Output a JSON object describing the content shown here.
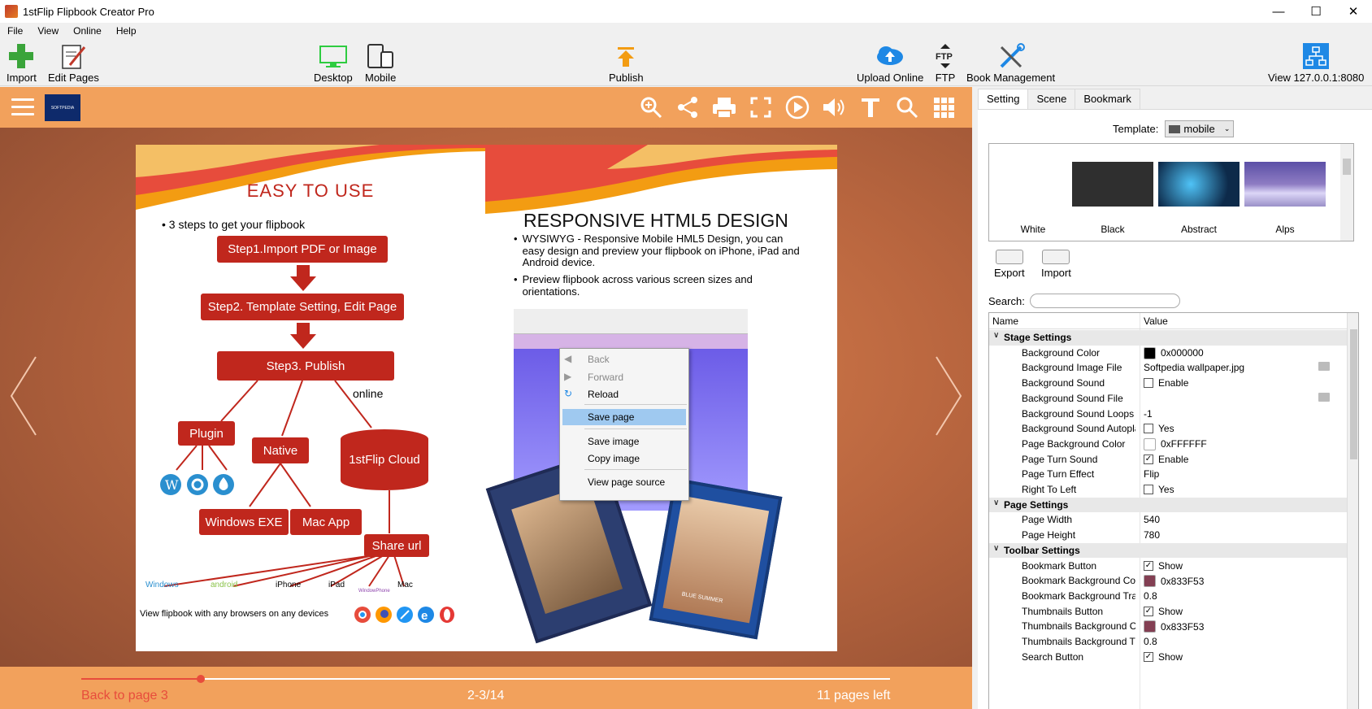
{
  "window": {
    "title": "1stFlip Flipbook Creator Pro"
  },
  "menu": [
    "File",
    "View",
    "Online",
    "Help"
  ],
  "toolbar": {
    "import": "Import",
    "edit_pages": "Edit Pages",
    "desktop": "Desktop",
    "mobile": "Mobile",
    "publish": "Publish",
    "upload_online": "Upload Online",
    "ftp": "FTP",
    "book_management": "Book Management",
    "view_local": "View 127.0.0.1:8080"
  },
  "viewer": {
    "logo_text": "SOFTPEDIA",
    "back_to_page": "Back to page 3",
    "page_indicator": "2-3/14",
    "pages_left": "11 pages left",
    "progress_fraction": 0.148
  },
  "left_page": {
    "title": "EASY TO USE",
    "bullet": "3 steps to get your flipbook",
    "step1": "Step1.Import PDF or Image",
    "step2": "Step2. Template Setting, Edit Page",
    "step3": "Step3. Publish",
    "online": "online",
    "plugin": "Plugin",
    "native": "Native",
    "cloud": "1stFlip Cloud",
    "windows_exe": "Windows EXE",
    "mac_app": "Mac App",
    "share_url": "Share url",
    "platforms": [
      "Windows",
      "android",
      "iPhone",
      "iPad",
      "WindowPhone",
      "Mac"
    ],
    "browsers_text": "View flipbook with any browsers on any devices"
  },
  "right_page": {
    "title": "RESPONSIVE HTML5 DESIGN",
    "bullet1": "WYSIWYG - Responsive Mobile HML5 Design, you can easy design and preview your flipbook on iPhone, iPad and Android device.",
    "bullet2": "Preview flipbook across various screen sizes and orientations.",
    "context_menu": [
      "Back",
      "Forward",
      "Reload",
      "Save page",
      "Save image",
      "Copy image",
      "View page source"
    ],
    "mock_cover_text": "BLUE SUMMER"
  },
  "panel": {
    "tabs": [
      "Setting",
      "Scene",
      "Bookmark"
    ],
    "active_tab": "Setting",
    "template_label": "Template:",
    "template_value": "mobile",
    "themes": [
      "White",
      "Black",
      "Abstract",
      "Alps"
    ],
    "export": "Export",
    "import": "Import",
    "search_label": "Search:",
    "search_placeholder": "",
    "columns": {
      "name": "Name",
      "value": "Value"
    },
    "rows": [
      {
        "type": "section",
        "name": "Stage Settings"
      },
      {
        "name": "Background Color",
        "value": "0x000000",
        "swatch": "#000000"
      },
      {
        "name": "Background Image File",
        "value": "Softpedia wallpaper.jpg",
        "folder": true
      },
      {
        "name": "Background Sound",
        "value": "Enable",
        "check": false
      },
      {
        "name": "Background Sound File",
        "value": "",
        "folder": true
      },
      {
        "name": "Background Sound Loops",
        "value": "-1"
      },
      {
        "name": "Background Sound Autoplay",
        "value": "Yes",
        "check": false
      },
      {
        "name": "Page Background Color",
        "value": "0xFFFFFF",
        "swatch": "#ffffff"
      },
      {
        "name": "Page Turn Sound",
        "value": "Enable",
        "check": true
      },
      {
        "name": "Page Turn Effect",
        "value": "Flip"
      },
      {
        "name": "Right To Left",
        "value": "Yes",
        "check": false
      },
      {
        "type": "section",
        "name": "Page Settings"
      },
      {
        "name": "Page Width",
        "value": "540"
      },
      {
        "name": "Page Height",
        "value": "780"
      },
      {
        "type": "section",
        "name": "Toolbar Settings"
      },
      {
        "name": "Bookmark Button",
        "value": "Show",
        "check": true
      },
      {
        "name": "Bookmark Background Color",
        "value": "0x833F53",
        "swatch": "#833f53"
      },
      {
        "name": "Bookmark Background Tra...",
        "value": "0.8"
      },
      {
        "name": "Thumbnails Button",
        "value": "Show",
        "check": true
      },
      {
        "name": "Thumbnails Background C...",
        "value": "0x833F53",
        "swatch": "#833f53"
      },
      {
        "name": "Thumbnails Background Tr...",
        "value": "0.8"
      },
      {
        "name": "Search Button",
        "value": "Show",
        "check": true
      }
    ]
  },
  "watermark": "SOFTPEDIA"
}
